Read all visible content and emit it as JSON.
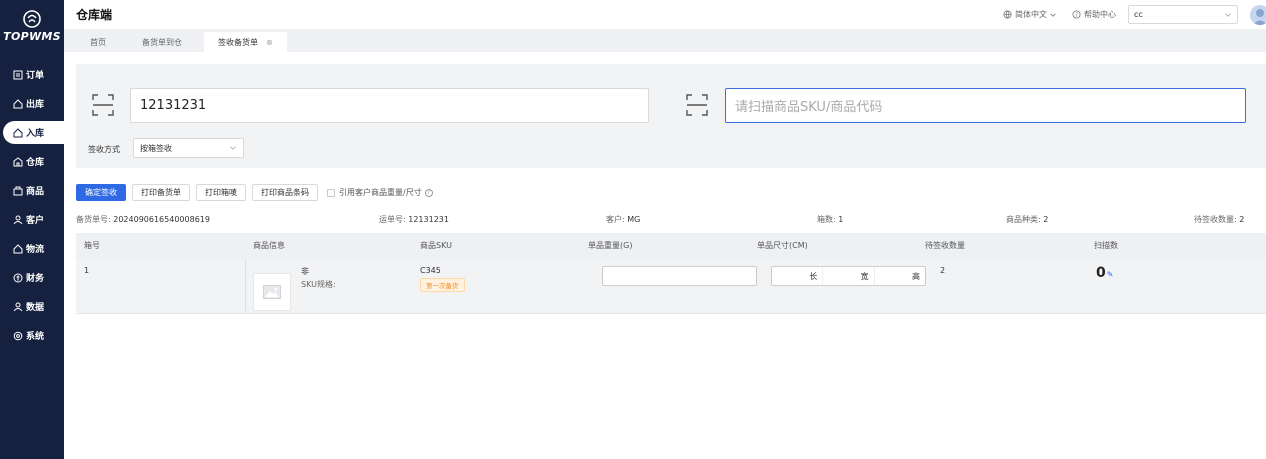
{
  "app": {
    "logo_text": "TOPWMS",
    "title": "仓库端"
  },
  "sidebar": {
    "items": [
      {
        "label": "订单",
        "icon": "order-icon"
      },
      {
        "label": "出库",
        "icon": "outbound-icon"
      },
      {
        "label": "入库",
        "icon": "inbound-icon",
        "active": true
      },
      {
        "label": "仓库",
        "icon": "warehouse-icon"
      },
      {
        "label": "商品",
        "icon": "product-icon"
      },
      {
        "label": "客户",
        "icon": "customer-icon"
      },
      {
        "label": "物流",
        "icon": "logistics-icon"
      },
      {
        "label": "财务",
        "icon": "finance-icon"
      },
      {
        "label": "数据",
        "icon": "data-icon"
      },
      {
        "label": "系统",
        "icon": "settings-icon"
      }
    ]
  },
  "header": {
    "language": "简体中文",
    "help": "帮助中心",
    "user": "cc"
  },
  "tabs": [
    {
      "label": "首页"
    },
    {
      "label": "备货单到仓"
    },
    {
      "label": "签收备货单",
      "active": true
    }
  ],
  "scan": {
    "order_value": "12131231",
    "sku_placeholder": "请扫描商品SKU/商品代码",
    "method_label": "签收方式",
    "method_value": "按箱签收"
  },
  "toolbar": {
    "confirm": "确定签收",
    "print_order": "打印备货单",
    "print_box": "打印箱唛",
    "print_barcode": "打印商品条码",
    "use_customer_dims": "引用客户商品重量/尺寸"
  },
  "summary": {
    "order_no_label": "备货单号:",
    "order_no": "2024090616540008619",
    "tracking_label": "运单号:",
    "tracking": "12131231",
    "customer_label": "客户:",
    "customer": "MG",
    "boxes_label": "箱数:",
    "boxes": "1",
    "sku_types_label": "商品种类:",
    "sku_types": "2",
    "pending_label": "待签收数量:",
    "pending": "2"
  },
  "table": {
    "columns": [
      "箱号",
      "商品信息",
      "商品SKU",
      "单品重量(G)",
      "单品尺寸(CM)",
      "待签收数量",
      "扫描数"
    ],
    "rows": [
      {
        "box_no": "1",
        "product_name": "非",
        "sku_spec": "SKU规格:",
        "sku": "C345",
        "tag": "第一次备货",
        "length": "长",
        "width": "宽",
        "height": "高",
        "pending_qty": "2",
        "scan_count": "0"
      }
    ]
  }
}
